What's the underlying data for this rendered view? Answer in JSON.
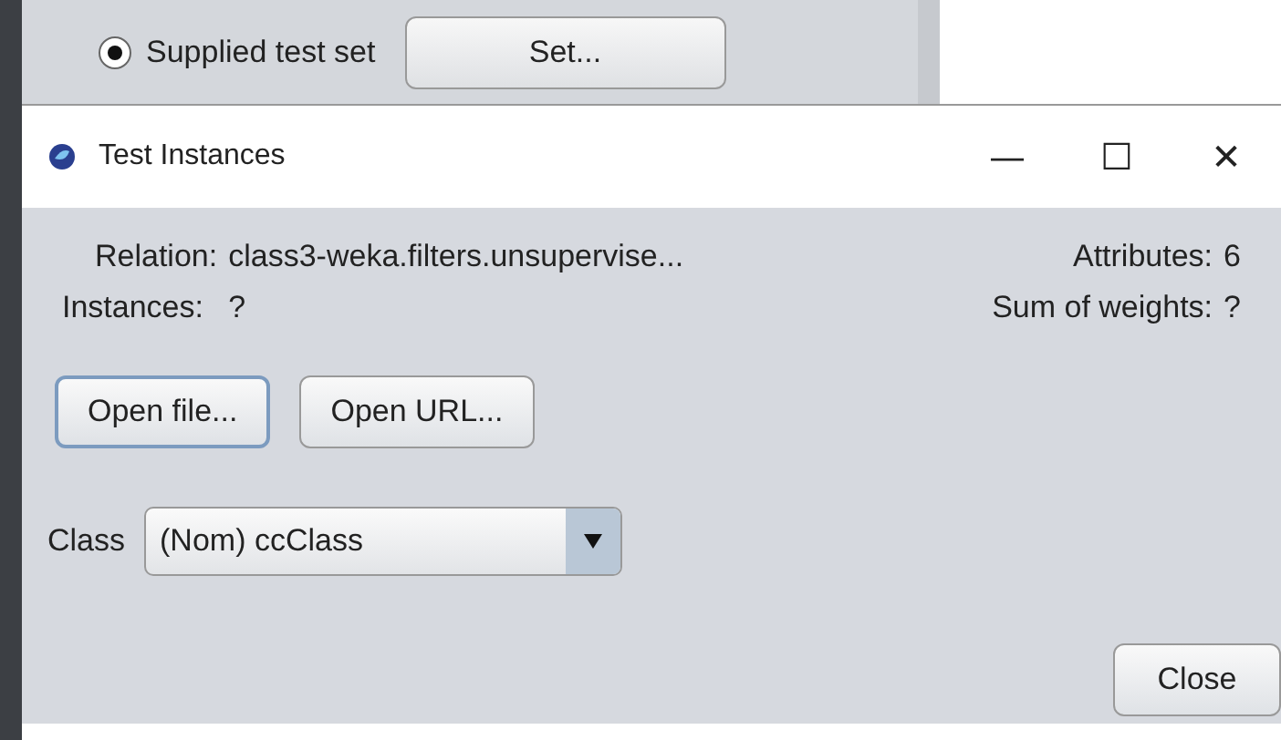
{
  "background": {
    "test_option": {
      "label": "Supplied test set",
      "selected": true
    },
    "set_button": "Set..."
  },
  "window": {
    "title": "Test Instances",
    "controls": [
      "—",
      "☐",
      "✕"
    ]
  },
  "info": {
    "relation_label": "Relation:",
    "relation_value": "class3-weka.filters.unsupervise...",
    "attributes_label": "Attributes:",
    "attributes_value": "6",
    "instances_label": "Instances:",
    "instances_value": "?",
    "weights_label": "Sum of weights:",
    "weights_value": "?"
  },
  "buttons": [
    {
      "label": "Open file...",
      "selected": true
    },
    {
      "label": "Open URL...",
      "selected": false
    }
  ],
  "class_select": {
    "label": "Class",
    "value": "(Nom) ccClass"
  },
  "close_button": "Close"
}
